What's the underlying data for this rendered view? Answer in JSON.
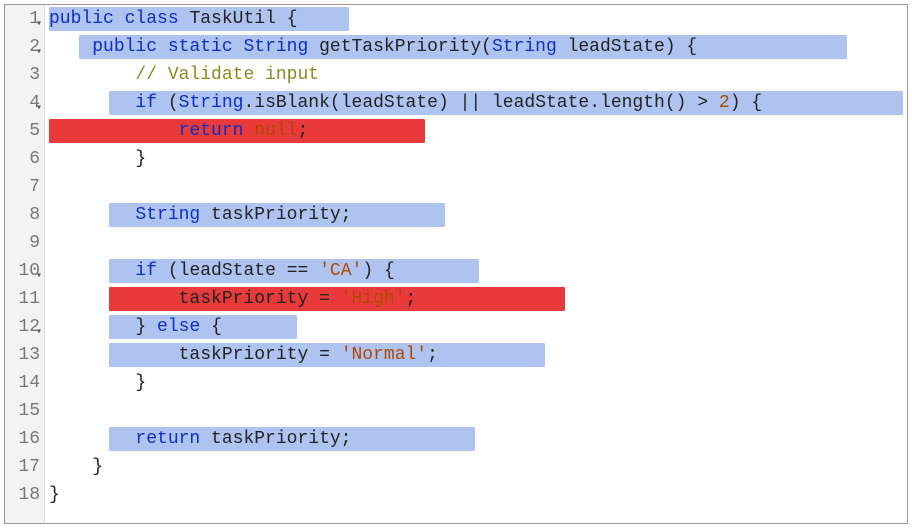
{
  "gutter": {
    "lines": [
      "1",
      "2",
      "3",
      "4",
      "5",
      "6",
      "7",
      "8",
      "9",
      "10",
      "11",
      "12",
      "13",
      "14",
      "15",
      "16",
      "17",
      "18"
    ],
    "folds": [
      1,
      2,
      4,
      10,
      12
    ]
  },
  "code": {
    "l1": {
      "kw1": "public",
      "kw2": "class",
      "name": "TaskUtil",
      "brace": "{"
    },
    "l2": {
      "kw1": "public",
      "kw2": "static",
      "type": "String",
      "method": "getTaskPriority",
      "paren1": "(",
      "ptype": "String",
      "pname": "leadState",
      "paren2": ")",
      "brace": "{"
    },
    "l3": {
      "comment": "// Validate input"
    },
    "l4": {
      "kw": "if",
      "p1": "(",
      "type": "String",
      "dot": ".",
      "m1": "isBlank",
      "p2": "(",
      "arg": "leadState",
      "p3": ")",
      "op": "||",
      "v2": "leadState",
      "dot2": ".",
      "m2": "length",
      "p4": "()",
      "gt": ">",
      "num": "2",
      "p5": ")",
      "brace": "{"
    },
    "l5": {
      "kw": "return",
      "val": "null",
      "semi": ";"
    },
    "l6": {
      "brace": "}"
    },
    "l8": {
      "type": "String",
      "name": "taskPriority",
      "semi": ";"
    },
    "l10": {
      "kw": "if",
      "p1": "(",
      "var": "leadState",
      "op": "==",
      "str": "'CA'",
      "p2": ")",
      "brace": "{"
    },
    "l11": {
      "var": "taskPriority",
      "eq": "=",
      "str": "'High'",
      "semi": ";"
    },
    "l12": {
      "brace": "}",
      "kw": "else",
      "brace2": "{"
    },
    "l13": {
      "var": "taskPriority",
      "eq": "=",
      "str": "'Normal'",
      "semi": ";"
    },
    "l14": {
      "brace": "}"
    },
    "l16": {
      "kw": "return",
      "var": "taskPriority",
      "semi": ";"
    },
    "l17": {
      "brace": "}"
    },
    "l18": {
      "brace": "}"
    }
  },
  "highlights": [
    {
      "line": 1,
      "from": 0,
      "to": 300,
      "color": "blue"
    },
    {
      "line": 2,
      "from": 30,
      "to": 800,
      "color": "blue"
    },
    {
      "line": 4,
      "from": 60,
      "to": 858,
      "color": "blue"
    },
    {
      "line": 5,
      "from": 0,
      "to": 380,
      "color": "red"
    },
    {
      "line": 8,
      "from": 60,
      "to": 400,
      "color": "blue"
    },
    {
      "line": 10,
      "from": 60,
      "to": 432,
      "color": "blue"
    },
    {
      "line": 11,
      "from": 60,
      "to": 520,
      "color": "red"
    },
    {
      "line": 12,
      "from": 60,
      "to": 250,
      "color": "blue"
    },
    {
      "line": 13,
      "from": 60,
      "to": 500,
      "color": "blue"
    },
    {
      "line": 16,
      "from": 60,
      "to": 430,
      "color": "blue"
    }
  ]
}
